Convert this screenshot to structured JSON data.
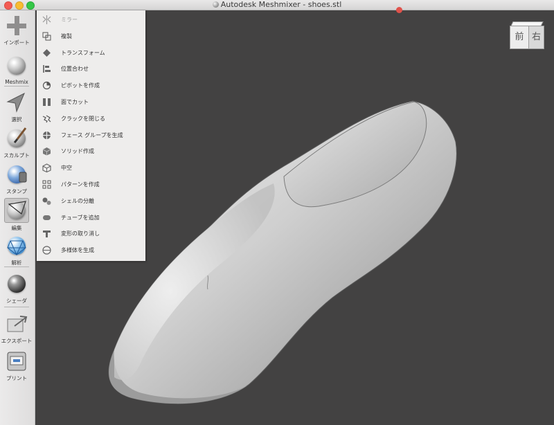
{
  "window": {
    "title": "Autodesk Meshmixer - shoes.stl"
  },
  "toolbar": {
    "items": [
      {
        "label": "インポート",
        "icon": "plus-icon"
      },
      {
        "label": "Meshmix",
        "icon": "meshmix-sphere-icon"
      },
      {
        "label": "選択",
        "icon": "select-arrow-icon"
      },
      {
        "label": "スカルプト",
        "icon": "sculpt-brush-icon"
      },
      {
        "label": "スタンプ",
        "icon": "stamp-icon"
      },
      {
        "label": "編集",
        "icon": "edit-icon",
        "active": true
      },
      {
        "label": "解析",
        "icon": "analysis-icon"
      },
      {
        "label": "シェーダ",
        "icon": "shader-sphere-icon"
      },
      {
        "label": "エクスポート",
        "icon": "export-icon"
      },
      {
        "label": "プリント",
        "icon": "print-icon"
      }
    ]
  },
  "edit_menu": {
    "items": [
      {
        "label": "ミラー",
        "icon": "mirror-icon",
        "enabled": false
      },
      {
        "label": "複製",
        "icon": "duplicate-icon",
        "enabled": true
      },
      {
        "label": "トランスフォーム",
        "icon": "transform-icon",
        "enabled": true
      },
      {
        "label": "位置合わせ",
        "icon": "align-icon",
        "enabled": true
      },
      {
        "label": "ピボットを作成",
        "icon": "pivot-icon",
        "enabled": true
      },
      {
        "label": "面でカット",
        "icon": "plane-cut-icon",
        "enabled": true
      },
      {
        "label": "クラックを閉じる",
        "icon": "close-cracks-icon",
        "enabled": true
      },
      {
        "label": "フェース グループを生成",
        "icon": "face-groups-icon",
        "enabled": true
      },
      {
        "label": "ソリッド作成",
        "icon": "make-solid-icon",
        "enabled": true
      },
      {
        "label": "中空",
        "icon": "hollow-icon",
        "enabled": true
      },
      {
        "label": "パターンを作成",
        "icon": "pattern-icon",
        "enabled": true
      },
      {
        "label": "シェルの分離",
        "icon": "separate-shells-icon",
        "enabled": true
      },
      {
        "label": "チューブを追加",
        "icon": "add-tube-icon",
        "enabled": true
      },
      {
        "label": "変形の取り消し",
        "icon": "undo-deform-icon",
        "enabled": true
      },
      {
        "label": "多様体を生成",
        "icon": "manifold-icon",
        "enabled": true
      }
    ]
  },
  "view_cube": {
    "front": "前",
    "right": "右"
  },
  "colors": {
    "viewport": "#434242",
    "toolbar": "#e5e4e4",
    "menu": "#eeedec",
    "model": "#c8c8c8"
  }
}
